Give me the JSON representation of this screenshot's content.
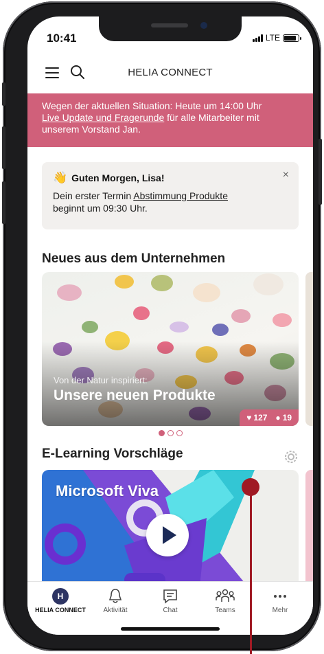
{
  "status_bar": {
    "time": "10:41",
    "network": "LTE",
    "battery_level": 0.85
  },
  "header": {
    "title": "HELIA CONNECT",
    "menu_icon": "hamburger-menu-icon",
    "search_icon": "search-icon"
  },
  "banner": {
    "text_before": "Wegen der aktuellen Situation: Heute um 14:00 Uhr",
    "link": "Live Update und Fragerunde",
    "text_after": "für alle Mitarbeiter mit unserem Vorstand Jan."
  },
  "greeting": {
    "emoji": "👋",
    "title": "Guten Morgen, Lisa!",
    "text_before": "Dein erster Termin",
    "link": "Abstimmung Produkte",
    "text_after": "beginnt um 09:30 Uhr.",
    "close": "×"
  },
  "news": {
    "section_title": "Neues aus dem Unternehmen",
    "card": {
      "kicker": "Von der Natur inspiriert:",
      "headline": "Unsere neuen Produkte",
      "likes": "127",
      "comments": "19"
    },
    "carousel_pages": 3,
    "active_page": 1
  },
  "learning": {
    "section_title": "E-Learning Vorschläge",
    "card": {
      "title": "Microsoft Viva"
    }
  },
  "tabbar": {
    "items": [
      {
        "label": "HELIA CONNECT",
        "icon": "avatar-icon",
        "avatar_letter": "H",
        "active": true
      },
      {
        "label": "Aktivität",
        "icon": "bell-icon",
        "active": false
      },
      {
        "label": "Chat",
        "icon": "chat-icon",
        "active": false
      },
      {
        "label": "Teams",
        "icon": "teams-icon",
        "active": false
      },
      {
        "label": "Mehr",
        "icon": "more-icon",
        "active": false
      }
    ]
  },
  "colors": {
    "accent": "#d0607a",
    "navy": "#2d3463",
    "marker": "#a01a24"
  }
}
